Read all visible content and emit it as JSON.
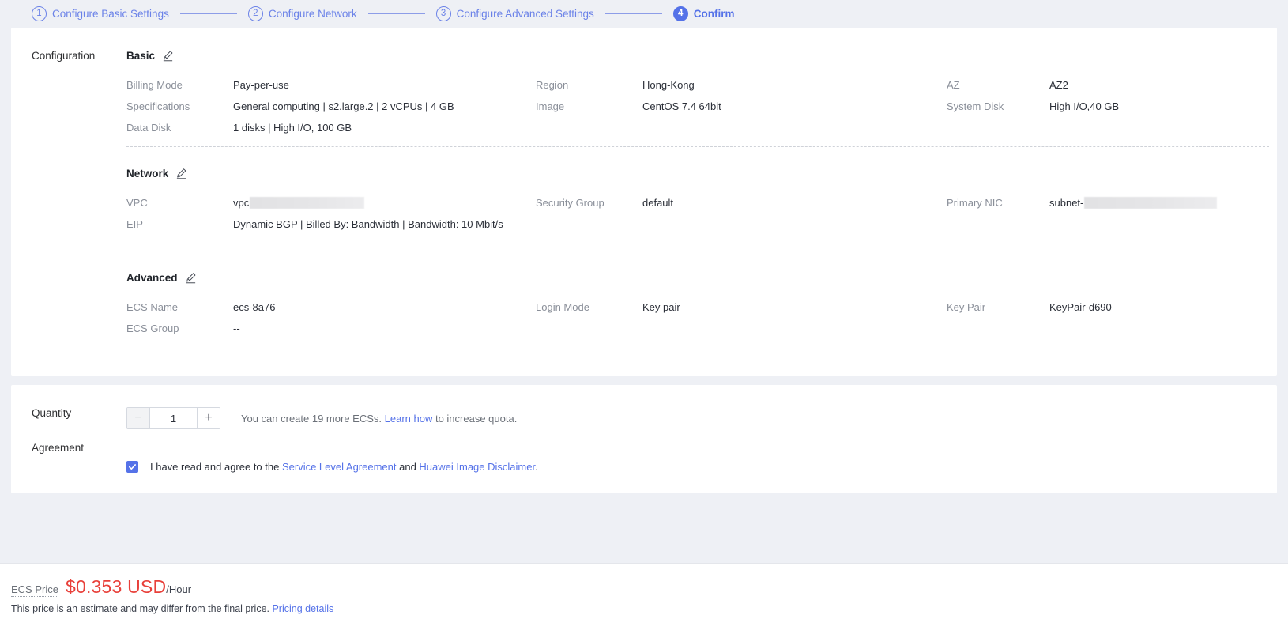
{
  "stepper": {
    "steps": [
      {
        "num": "1",
        "label": "Configure Basic Settings",
        "active": false
      },
      {
        "num": "2",
        "label": "Configure Network",
        "active": false
      },
      {
        "num": "3",
        "label": "Configure Advanced Settings",
        "active": false
      },
      {
        "num": "4",
        "label": "Confirm",
        "active": true
      }
    ],
    "accent_color": "#5572e8",
    "inactive_color": "#6b82e8"
  },
  "configuration": {
    "row_label": "Configuration",
    "groups": [
      {
        "title": "Basic",
        "edit_icon": "pencil-icon",
        "fields": [
          {
            "key": "Billing Mode",
            "value": "Pay-per-use"
          },
          {
            "key": "Region",
            "value": "Hong-Kong"
          },
          {
            "key": "AZ",
            "value": "AZ2"
          },
          {
            "key": "Specifications",
            "value": "General computing | s2.large.2 | 2 vCPUs | 4 GB"
          },
          {
            "key": "Image",
            "value": "CentOS 7.4 64bit"
          },
          {
            "key": "System Disk",
            "value": "High I/O,40 GB"
          },
          {
            "key": "Data Disk",
            "value": "1 disks | High I/O, 100 GB"
          },
          {
            "key": "",
            "value": ""
          },
          {
            "key": "",
            "value": ""
          }
        ]
      },
      {
        "title": "Network",
        "edit_icon": "pencil-icon",
        "fields": [
          {
            "key": "VPC",
            "value": "vpc",
            "redacted": true,
            "redact_width": 145
          },
          {
            "key": "Security Group",
            "value": "default"
          },
          {
            "key": "Primary NIC",
            "value": "subnet-",
            "redacted": true,
            "redact_width": 168
          },
          {
            "key": "EIP",
            "value": "Dynamic BGP | Billed By: Bandwidth | Bandwidth: 10 Mbit/s"
          },
          {
            "key": "",
            "value": ""
          },
          {
            "key": "",
            "value": ""
          }
        ]
      },
      {
        "title": "Advanced",
        "edit_icon": "pencil-icon",
        "fields": [
          {
            "key": "ECS Name",
            "value": "ecs-8a76"
          },
          {
            "key": "Login Mode",
            "value": "Key pair"
          },
          {
            "key": "Key Pair",
            "value": "KeyPair-d690"
          },
          {
            "key": "ECS Group",
            "value": "--"
          },
          {
            "key": "",
            "value": ""
          },
          {
            "key": "",
            "value": ""
          }
        ]
      }
    ]
  },
  "order": {
    "quantity": {
      "row_label": "Quantity",
      "decrement_label": "−",
      "increment_label": "+",
      "value": "1",
      "hint_prefix": "You can create 19 more ECSs. ",
      "hint_link": "Learn how",
      "hint_suffix": " to increase quota."
    },
    "agreement": {
      "row_label": "Agreement",
      "checked": true,
      "text_prefix": "I have read and agree to the ",
      "link1": "Service Level Agreement",
      "text_middle": " and ",
      "link2": "Huawei Image Disclaimer",
      "text_suffix": "."
    }
  },
  "footer": {
    "price_label": "ECS Price",
    "price_amount": "$0.353 USD",
    "price_unit": "/Hour",
    "note_text": "This price is an estimate and may differ from the final price. ",
    "note_link": "Pricing details",
    "price_color": "#e8403a"
  }
}
